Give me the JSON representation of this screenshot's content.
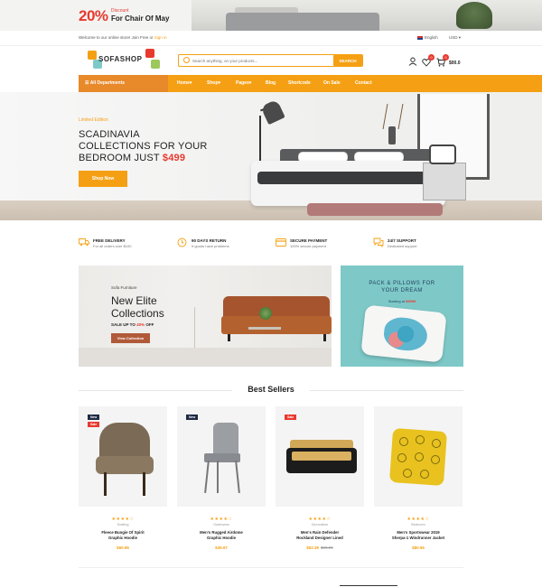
{
  "promo": {
    "percent": "20%",
    "small": "Discount",
    "title": "For Chair Of May"
  },
  "utility": {
    "welcome": "Welcome to our online store! Join Free or ",
    "welcome_link": "Sign in",
    "language": "English",
    "currency": "USD"
  },
  "header": {
    "logo_text": "SOFASHOP",
    "search_placeholder": "Search anything, on your products...",
    "search_button": "SEARCH",
    "cart_total": "$00.0",
    "wishlist_count": "0",
    "cart_count": "0"
  },
  "nav": {
    "departments": "All Departments",
    "items": [
      "Home",
      "Shop",
      "Pages",
      "Blog",
      "Shortcode",
      "On Sale",
      "Contact"
    ]
  },
  "hero": {
    "subtitle": "Limited Edition",
    "title_line1": "SCADINAVIA",
    "title_line2": "COLLECTIONS FOR YOUR",
    "title_line3": "BEDROOM JUST",
    "price": "$499",
    "button": "Shop Now"
  },
  "features": [
    {
      "title": "FREE DELIVERY",
      "desc": "For all orders over $100",
      "icon": "truck-icon"
    },
    {
      "title": "90 DAYS RETURN",
      "desc": "If goods have problems",
      "icon": "return-icon"
    },
    {
      "title": "SECURE PAYMENT",
      "desc": "100% secure payment",
      "icon": "card-icon"
    },
    {
      "title": "24/7 SUPPORT",
      "desc": "Dedicated support",
      "icon": "chat-icon"
    }
  ],
  "banner1": {
    "subtitle": "Sofa Furniture",
    "title_line1": "New Elite",
    "title_line2": "Collections",
    "sale_prefix": "SALE UP TO ",
    "sale_pct": "40%",
    "sale_suffix": " OFF",
    "button": "View Collection"
  },
  "banner2": {
    "title_line1": "PACK & PILLOWS FOR",
    "title_line2": "YOUR DREAM",
    "sub_prefix": "Starting at ",
    "price": "$9999"
  },
  "best_sellers": {
    "title": "Best Sellers",
    "products": [
      {
        "labels": [
          "New",
          "Sale"
        ],
        "stars": "★★★★☆",
        "category": "Seating",
        "name_line1": "Fleece Bungie Of Spirit",
        "name_line2": "Graphic Hoodie",
        "price": "$60.95",
        "old_price": ""
      },
      {
        "labels": [
          "New"
        ],
        "stars": "★★★★☆",
        "category": "Outerwear",
        "name_line1": "Men's Rugged Airdome",
        "name_line2": "Graphic Hoodie",
        "price": "$39.97",
        "old_price": ""
      },
      {
        "labels": [
          "Sale"
        ],
        "stars": "★★★★☆",
        "category": "Decoration",
        "name_line1": "Men's Rain Defender",
        "name_line2": "Rockland Designer Lined",
        "price": "$62.39",
        "old_price": "$90.99"
      },
      {
        "labels": [],
        "stars": "★★★★☆",
        "category": "Bedroom",
        "name_line1": "Men's Sportswear 2019",
        "name_line2": "Sherpa-1 Windrunner Jacket",
        "price": "$80.95",
        "old_price": ""
      }
    ]
  },
  "colors": {
    "accent": "#f5a014",
    "sale": "#e8392e",
    "new_badge": "#1f2a44"
  }
}
